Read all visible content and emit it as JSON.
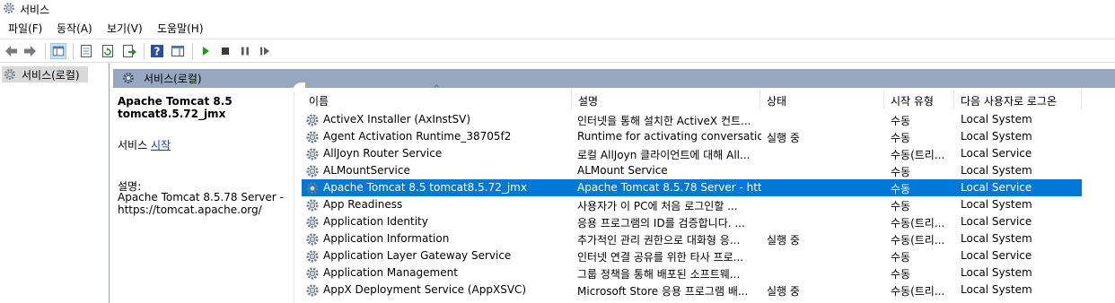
{
  "window": {
    "title": "서비스"
  },
  "menu": [
    "파일(F)",
    "동작(A)",
    "보기(V)",
    "도움말(H)"
  ],
  "toolbar": {
    "buttons": [
      "back-icon",
      "forward-icon",
      "show-hide-tree-icon",
      "properties-icon",
      "refresh-icon",
      "export-list-icon",
      "help-icon",
      "show-action-pane-icon",
      "start-service-icon",
      "stop-service-icon",
      "pause-service-icon",
      "restart-service-icon"
    ]
  },
  "tree": {
    "root": "서비스(로컬)"
  },
  "panel": {
    "title": "서비스(로컬)"
  },
  "details": {
    "name_line1": "Apache Tomcat 8.5",
    "name_line2": "tomcat8.5.72_jmx",
    "action_prefix": "서비스",
    "action_link": "시작",
    "desc_label": "설명:",
    "desc_line1": "Apache Tomcat 8.5.78 Server -",
    "desc_line2": "https://tomcat.apache.org/"
  },
  "columns": {
    "name": "이름",
    "description": "설명",
    "status": "상태",
    "startup": "시작 유형",
    "logon": "다음 사용자로 로그온"
  },
  "colors": {
    "selected_bg": "#0078d7",
    "panel_header": "#96a8c0"
  },
  "rows": [
    {
      "name": "ActiveX Installer (AxInstSV)",
      "description": "인터넷을 통해 설치한 ActiveX 컨트...",
      "status": "",
      "startup": "수동",
      "logon": "Local System"
    },
    {
      "name": "Agent Activation Runtime_38705f2",
      "description": "Runtime for activating conversatio...",
      "status": "실행 중",
      "startup": "수동",
      "logon": "Local System"
    },
    {
      "name": "AllJoyn Router Service",
      "description": "로컬 AllJoyn 클라이언트에 대해 All...",
      "status": "",
      "startup": "수동(트리...",
      "logon": "Local Service"
    },
    {
      "name": "ALMountService",
      "description": "ALMount Service",
      "status": "",
      "startup": "수동",
      "logon": "Local System"
    },
    {
      "name": "Apache Tomcat 8.5 tomcat8.5.72_jmx",
      "description": "Apache Tomcat 8.5.78 Server - htt...",
      "status": "",
      "startup": "수동",
      "logon": "Local Service",
      "selected": true
    },
    {
      "name": "App Readiness",
      "description": "사용자가 이 PC에 처음 로그인할 ...",
      "status": "",
      "startup": "수동",
      "logon": "Local System"
    },
    {
      "name": "Application Identity",
      "description": "응용 프로그램의 ID를 검증합니다. ...",
      "status": "",
      "startup": "수동(트리...",
      "logon": "Local Service"
    },
    {
      "name": "Application Information",
      "description": "추가적인 관리 권한으로 대화형 응...",
      "status": "실행 중",
      "startup": "수동(트리...",
      "logon": "Local System"
    },
    {
      "name": "Application Layer Gateway Service",
      "description": "인터넷 연결 공유를 위한 타사 프로...",
      "status": "",
      "startup": "수동",
      "logon": "Local Service"
    },
    {
      "name": "Application Management",
      "description": "그룹 정책을 통해 배포된 소프트웨...",
      "status": "",
      "startup": "수동",
      "logon": "Local System"
    },
    {
      "name": "AppX Deployment Service (AppXSVC)",
      "description": "Microsoft Store 응용 프로그램 배...",
      "status": "실행 중",
      "startup": "수동(트리...",
      "logon": "Local System"
    }
  ]
}
